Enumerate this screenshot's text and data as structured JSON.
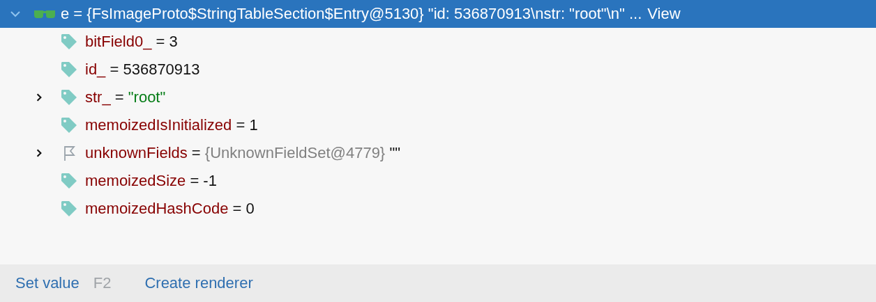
{
  "root": {
    "expanded": true,
    "selected": true,
    "name": "e",
    "operator": "=",
    "value": "{FsImageProto$StringTableSection$Entry@5130}",
    "preview": "\"id: 536870913\\nstr: \"root\"\\n\" ...",
    "link": "View",
    "children": [
      {
        "kind": "field",
        "expandable": false,
        "name": "bitField0_",
        "operator": "=",
        "value": {
          "kind": "number",
          "text": "3"
        }
      },
      {
        "kind": "field",
        "expandable": false,
        "name": "id_",
        "operator": "=",
        "value": {
          "kind": "number",
          "text": "536870913"
        }
      },
      {
        "kind": "field",
        "expandable": true,
        "expanded": false,
        "name": "str_",
        "operator": "=",
        "value": {
          "kind": "string",
          "text": "\"root\""
        }
      },
      {
        "kind": "field",
        "expandable": false,
        "name": "memoizedIsInitialized",
        "operator": "=",
        "value": {
          "kind": "number",
          "text": "1"
        }
      },
      {
        "kind": "flag",
        "expandable": true,
        "expanded": false,
        "name": "unknownFields",
        "operator": "=",
        "value": {
          "kind": "object",
          "text": "{UnknownFieldSet@4779}"
        },
        "extra": "\"\""
      },
      {
        "kind": "field",
        "expandable": false,
        "name": "memoizedSize",
        "operator": "=",
        "value": {
          "kind": "number",
          "text": "-1"
        }
      },
      {
        "kind": "field",
        "expandable": false,
        "name": "memoizedHashCode",
        "operator": "=",
        "value": {
          "kind": "number",
          "text": "0"
        }
      }
    ]
  },
  "footer": {
    "actions": [
      {
        "label": "Set value",
        "shortcut": "F2"
      },
      {
        "label": "Create renderer"
      }
    ]
  }
}
